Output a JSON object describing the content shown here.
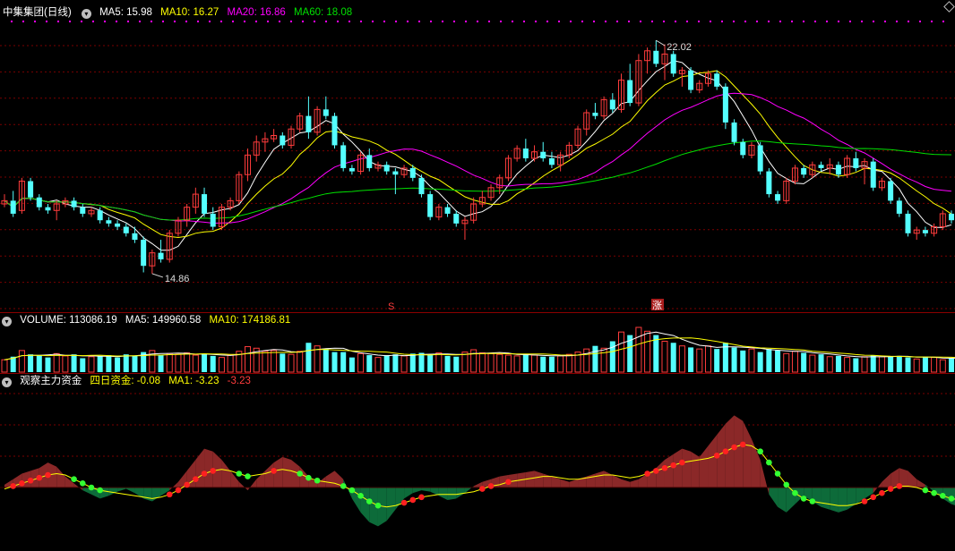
{
  "colors": {
    "up": "#ff3c3c",
    "down": "#54ffff",
    "ma5": "#ffffff",
    "ma10": "#ffff00",
    "ma20": "#ff00ff",
    "ma60": "#00e000",
    "grid": "#7a0000",
    "fundUp": "#8b2828",
    "fundDown": "#0d6b3a"
  },
  "price_panel": {
    "stock_name": "中集集团(日线)",
    "ma5_label": "MA5: 15.98",
    "ma10_label": "MA10: 16.27",
    "ma20_label": "MA20: 16.86",
    "ma60_label": "MA60: 18.08",
    "high_marker": "22.02",
    "low_marker": "14.86",
    "marker_s": "S",
    "marker_zhang": "涨",
    "collapse_icon": "chevron-down-icon"
  },
  "volume_panel": {
    "volume_label": "VOLUME: 113086.19",
    "ma5_label": "MA5: 149960.58",
    "ma10_label": "MA10: 174186.81"
  },
  "fund_panel": {
    "title": "观察主力资金",
    "four_day_label": "四日资金: -0.08",
    "ma1_label": "MA1: -3.23",
    "extra_value": "-3.23"
  },
  "chart_data": {
    "type": "candlestick",
    "ylim": [
      14.2,
      22.6
    ],
    "candles": [
      {
        "o": 17.0,
        "h": 17.3,
        "l": 16.9,
        "c": 17.1
      },
      {
        "o": 17.1,
        "h": 17.4,
        "l": 16.6,
        "c": 16.7
      },
      {
        "o": 16.8,
        "h": 17.8,
        "l": 16.7,
        "c": 17.7
      },
      {
        "o": 17.7,
        "h": 17.8,
        "l": 17.1,
        "c": 17.2
      },
      {
        "o": 17.2,
        "h": 17.3,
        "l": 16.8,
        "c": 16.9
      },
      {
        "o": 16.9,
        "h": 17.0,
        "l": 16.7,
        "c": 16.8
      },
      {
        "o": 16.8,
        "h": 17.1,
        "l": 16.5,
        "c": 17.0
      },
      {
        "o": 17.0,
        "h": 17.2,
        "l": 16.9,
        "c": 17.1
      },
      {
        "o": 17.1,
        "h": 17.2,
        "l": 16.8,
        "c": 16.9
      },
      {
        "o": 16.9,
        "h": 17.0,
        "l": 16.6,
        "c": 16.7
      },
      {
        "o": 16.7,
        "h": 16.9,
        "l": 16.6,
        "c": 16.8
      },
      {
        "o": 16.8,
        "h": 16.9,
        "l": 16.4,
        "c": 16.5
      },
      {
        "o": 16.5,
        "h": 16.6,
        "l": 16.3,
        "c": 16.4
      },
      {
        "o": 16.4,
        "h": 16.5,
        "l": 16.2,
        "c": 16.3
      },
      {
        "o": 16.3,
        "h": 16.4,
        "l": 16.0,
        "c": 16.1
      },
      {
        "o": 16.1,
        "h": 16.3,
        "l": 15.8,
        "c": 15.9
      },
      {
        "o": 15.9,
        "h": 16.0,
        "l": 14.9,
        "c": 15.1
      },
      {
        "o": 15.1,
        "h": 15.6,
        "l": 14.86,
        "c": 15.5
      },
      {
        "o": 15.5,
        "h": 15.9,
        "l": 15.2,
        "c": 15.3
      },
      {
        "o": 15.3,
        "h": 16.2,
        "l": 15.2,
        "c": 16.1
      },
      {
        "o": 16.1,
        "h": 16.6,
        "l": 16.0,
        "c": 16.5
      },
      {
        "o": 16.5,
        "h": 17.0,
        "l": 16.3,
        "c": 16.9
      },
      {
        "o": 16.9,
        "h": 17.5,
        "l": 16.7,
        "c": 17.3
      },
      {
        "o": 17.3,
        "h": 17.5,
        "l": 16.6,
        "c": 16.7
      },
      {
        "o": 16.7,
        "h": 16.9,
        "l": 16.2,
        "c": 16.3
      },
      {
        "o": 16.3,
        "h": 17.0,
        "l": 16.2,
        "c": 16.9
      },
      {
        "o": 16.9,
        "h": 17.2,
        "l": 16.8,
        "c": 17.1
      },
      {
        "o": 17.1,
        "h": 18.0,
        "l": 17.0,
        "c": 17.9
      },
      {
        "o": 17.9,
        "h": 18.7,
        "l": 17.7,
        "c": 18.5
      },
      {
        "o": 18.5,
        "h": 19.1,
        "l": 18.3,
        "c": 18.9
      },
      {
        "o": 18.9,
        "h": 19.2,
        "l": 18.6,
        "c": 19.0
      },
      {
        "o": 19.0,
        "h": 19.3,
        "l": 18.9,
        "c": 19.1
      },
      {
        "o": 19.1,
        "h": 19.2,
        "l": 18.7,
        "c": 18.8
      },
      {
        "o": 18.8,
        "h": 19.4,
        "l": 18.7,
        "c": 19.3
      },
      {
        "o": 19.3,
        "h": 19.8,
        "l": 19.2,
        "c": 19.7
      },
      {
        "o": 19.7,
        "h": 20.3,
        "l": 19.0,
        "c": 19.2
      },
      {
        "o": 19.2,
        "h": 20.0,
        "l": 19.1,
        "c": 19.9
      },
      {
        "o": 19.9,
        "h": 20.3,
        "l": 19.6,
        "c": 19.7
      },
      {
        "o": 19.7,
        "h": 19.8,
        "l": 18.7,
        "c": 18.8
      },
      {
        "o": 18.8,
        "h": 18.9,
        "l": 18.0,
        "c": 18.1
      },
      {
        "o": 18.1,
        "h": 18.2,
        "l": 17.9,
        "c": 18.0
      },
      {
        "o": 18.0,
        "h": 18.6,
        "l": 17.9,
        "c": 18.5
      },
      {
        "o": 18.5,
        "h": 18.7,
        "l": 18.0,
        "c": 18.1
      },
      {
        "o": 18.1,
        "h": 18.3,
        "l": 18.0,
        "c": 18.2
      },
      {
        "o": 18.2,
        "h": 18.3,
        "l": 17.9,
        "c": 18.0
      },
      {
        "o": 18.0,
        "h": 18.1,
        "l": 17.3,
        "c": 17.9
      },
      {
        "o": 17.9,
        "h": 18.2,
        "l": 17.8,
        "c": 18.1
      },
      {
        "o": 18.1,
        "h": 18.2,
        "l": 17.7,
        "c": 17.8
      },
      {
        "o": 17.8,
        "h": 17.9,
        "l": 17.2,
        "c": 17.3
      },
      {
        "o": 17.3,
        "h": 17.4,
        "l": 16.5,
        "c": 16.6
      },
      {
        "o": 16.6,
        "h": 17.0,
        "l": 16.5,
        "c": 16.9
      },
      {
        "o": 16.9,
        "h": 17.0,
        "l": 16.6,
        "c": 16.7
      },
      {
        "o": 16.7,
        "h": 16.8,
        "l": 16.3,
        "c": 16.4
      },
      {
        "o": 16.4,
        "h": 16.6,
        "l": 15.9,
        "c": 16.5
      },
      {
        "o": 16.5,
        "h": 17.2,
        "l": 16.4,
        "c": 17.0
      },
      {
        "o": 17.0,
        "h": 17.4,
        "l": 16.9,
        "c": 17.2
      },
      {
        "o": 17.2,
        "h": 17.6,
        "l": 17.1,
        "c": 17.5
      },
      {
        "o": 17.5,
        "h": 17.9,
        "l": 17.3,
        "c": 17.8
      },
      {
        "o": 17.8,
        "h": 18.5,
        "l": 17.7,
        "c": 18.4
      },
      {
        "o": 18.4,
        "h": 18.8,
        "l": 18.3,
        "c": 18.7
      },
      {
        "o": 18.7,
        "h": 19.0,
        "l": 18.3,
        "c": 18.4
      },
      {
        "o": 18.4,
        "h": 18.8,
        "l": 18.3,
        "c": 18.6
      },
      {
        "o": 18.6,
        "h": 18.9,
        "l": 18.3,
        "c": 18.4
      },
      {
        "o": 18.4,
        "h": 18.6,
        "l": 18.1,
        "c": 18.2
      },
      {
        "o": 18.2,
        "h": 18.6,
        "l": 18.0,
        "c": 18.5
      },
      {
        "o": 18.5,
        "h": 18.9,
        "l": 18.4,
        "c": 18.8
      },
      {
        "o": 18.8,
        "h": 19.4,
        "l": 18.7,
        "c": 19.3
      },
      {
        "o": 19.3,
        "h": 19.9,
        "l": 19.1,
        "c": 19.8
      },
      {
        "o": 19.8,
        "h": 20.1,
        "l": 19.6,
        "c": 19.7
      },
      {
        "o": 19.7,
        "h": 20.3,
        "l": 19.6,
        "c": 20.2
      },
      {
        "o": 20.2,
        "h": 20.4,
        "l": 19.8,
        "c": 19.9
      },
      {
        "o": 19.9,
        "h": 21.0,
        "l": 19.8,
        "c": 20.8
      },
      {
        "o": 20.8,
        "h": 21.3,
        "l": 20.0,
        "c": 20.1
      },
      {
        "o": 20.1,
        "h": 21.6,
        "l": 20.0,
        "c": 21.4
      },
      {
        "o": 21.4,
        "h": 21.8,
        "l": 21.0,
        "c": 21.7
      },
      {
        "o": 21.7,
        "h": 22.02,
        "l": 21.2,
        "c": 21.3
      },
      {
        "o": 21.3,
        "h": 21.9,
        "l": 20.8,
        "c": 21.6
      },
      {
        "o": 21.6,
        "h": 21.7,
        "l": 20.9,
        "c": 21.0
      },
      {
        "o": 21.0,
        "h": 21.2,
        "l": 20.6,
        "c": 21.1
      },
      {
        "o": 21.1,
        "h": 21.2,
        "l": 20.4,
        "c": 20.5
      },
      {
        "o": 20.5,
        "h": 20.8,
        "l": 20.4,
        "c": 20.7
      },
      {
        "o": 20.7,
        "h": 21.1,
        "l": 20.6,
        "c": 21.0
      },
      {
        "o": 21.0,
        "h": 21.1,
        "l": 20.5,
        "c": 20.6
      },
      {
        "o": 20.6,
        "h": 20.7,
        "l": 19.3,
        "c": 19.5
      },
      {
        "o": 19.5,
        "h": 19.6,
        "l": 18.8,
        "c": 18.9
      },
      {
        "o": 18.9,
        "h": 19.0,
        "l": 18.4,
        "c": 18.5
      },
      {
        "o": 18.5,
        "h": 18.9,
        "l": 18.4,
        "c": 18.8
      },
      {
        "o": 18.8,
        "h": 18.9,
        "l": 17.9,
        "c": 18.0
      },
      {
        "o": 18.0,
        "h": 18.1,
        "l": 17.2,
        "c": 17.3
      },
      {
        "o": 17.3,
        "h": 17.4,
        "l": 17.0,
        "c": 17.1
      },
      {
        "o": 17.1,
        "h": 17.8,
        "l": 17.0,
        "c": 17.7
      },
      {
        "o": 17.7,
        "h": 18.2,
        "l": 17.6,
        "c": 18.1
      },
      {
        "o": 18.1,
        "h": 18.2,
        "l": 17.8,
        "c": 17.9
      },
      {
        "o": 17.9,
        "h": 18.3,
        "l": 17.8,
        "c": 18.2
      },
      {
        "o": 18.2,
        "h": 18.3,
        "l": 18.0,
        "c": 18.1
      },
      {
        "o": 18.1,
        "h": 18.4,
        "l": 17.9,
        "c": 18.2
      },
      {
        "o": 18.2,
        "h": 18.3,
        "l": 17.8,
        "c": 17.9
      },
      {
        "o": 17.9,
        "h": 18.5,
        "l": 17.8,
        "c": 18.4
      },
      {
        "o": 18.4,
        "h": 18.6,
        "l": 18.0,
        "c": 18.1
      },
      {
        "o": 18.1,
        "h": 18.4,
        "l": 17.6,
        "c": 18.3
      },
      {
        "o": 18.3,
        "h": 18.4,
        "l": 17.4,
        "c": 17.5
      },
      {
        "o": 17.5,
        "h": 17.8,
        "l": 17.4,
        "c": 17.7
      },
      {
        "o": 17.7,
        "h": 17.8,
        "l": 17.0,
        "c": 17.1
      },
      {
        "o": 17.1,
        "h": 17.2,
        "l": 16.6,
        "c": 16.7
      },
      {
        "o": 16.7,
        "h": 16.8,
        "l": 16.0,
        "c": 16.1
      },
      {
        "o": 16.1,
        "h": 16.3,
        "l": 15.9,
        "c": 16.2
      },
      {
        "o": 16.2,
        "h": 16.3,
        "l": 16.0,
        "c": 16.1
      },
      {
        "o": 16.1,
        "h": 16.4,
        "l": 16.0,
        "c": 16.3
      },
      {
        "o": 16.3,
        "h": 16.8,
        "l": 16.2,
        "c": 16.7
      },
      {
        "o": 16.7,
        "h": 16.8,
        "l": 16.4,
        "c": 16.5
      }
    ],
    "volume": [
      80,
      100,
      140,
      115,
      110,
      95,
      120,
      105,
      115,
      90,
      100,
      105,
      110,
      95,
      115,
      105,
      130,
      140,
      110,
      120,
      115,
      125,
      110,
      120,
      105,
      95,
      110,
      135,
      165,
      155,
      135,
      140,
      120,
      115,
      135,
      190,
      170,
      150,
      130,
      130,
      95,
      120,
      110,
      95,
      110,
      115,
      105,
      120,
      125,
      115,
      125,
      105,
      100,
      130,
      145,
      125,
      120,
      115,
      110,
      105,
      115,
      110,
      100,
      100,
      105,
      115,
      130,
      150,
      170,
      155,
      200,
      260,
      240,
      290,
      265,
      240,
      200,
      190,
      170,
      160,
      150,
      170,
      150,
      190,
      160,
      140,
      150,
      130,
      150,
      140,
      120,
      135,
      125,
      110,
      115,
      100,
      105,
      95,
      90,
      100,
      110,
      100,
      100,
      105,
      95,
      85,
      100,
      95,
      80,
      90,
      75
    ],
    "fund": [
      2,
      6,
      10,
      12,
      14,
      18,
      15,
      8,
      3,
      -2,
      -5,
      -8,
      -6,
      -3,
      -1,
      -4,
      -8,
      -10,
      -6,
      -2,
      4,
      12,
      20,
      28,
      26,
      20,
      12,
      4,
      -2,
      6,
      12,
      18,
      22,
      20,
      15,
      8,
      3,
      8,
      12,
      6,
      -8,
      -18,
      -25,
      -28,
      -24,
      -16,
      -8,
      -4,
      -2,
      -3,
      -6,
      -9,
      -8,
      -4,
      1,
      4,
      6,
      8,
      9,
      10,
      11,
      12,
      10,
      8,
      6,
      4,
      6,
      8,
      10,
      12,
      9,
      6,
      4,
      6,
      10,
      14,
      20,
      24,
      28,
      26,
      22,
      30,
      38,
      46,
      52,
      48,
      35,
      20,
      -5,
      -14,
      -18,
      -12,
      -6,
      -10,
      -14,
      -16,
      -18,
      -16,
      -12,
      -8,
      -4,
      4,
      10,
      14,
      12,
      6,
      2,
      -3,
      -8,
      -12,
      -14,
      -10,
      -6,
      -4
    ],
    "fund_ma": [
      -1,
      1,
      3,
      5,
      7,
      9,
      10,
      9,
      6,
      3,
      0,
      -2,
      -3,
      -4,
      -5,
      -6,
      -7,
      -8,
      -7,
      -5,
      -2,
      2,
      6,
      10,
      12,
      13,
      12,
      10,
      8,
      9,
      10,
      12,
      13,
      12,
      10,
      7,
      5,
      4,
      3,
      1,
      -2,
      -6,
      -10,
      -13,
      -14,
      -13,
      -11,
      -9,
      -7,
      -6,
      -5,
      -5,
      -5,
      -4,
      -3,
      -1,
      1,
      2,
      4,
      5,
      6,
      7,
      8,
      8,
      7,
      6,
      6,
      7,
      8,
      9,
      9,
      8,
      7,
      8,
      10,
      12,
      14,
      16,
      18,
      19,
      20,
      21,
      23,
      26,
      29,
      31,
      30,
      26,
      18,
      10,
      2,
      -4,
      -8,
      -10,
      -11,
      -12,
      -13,
      -13,
      -12,
      -10,
      -7,
      -4,
      -1,
      1,
      1,
      0,
      -2,
      -4,
      -6,
      -8,
      -9,
      -9,
      -8
    ]
  }
}
